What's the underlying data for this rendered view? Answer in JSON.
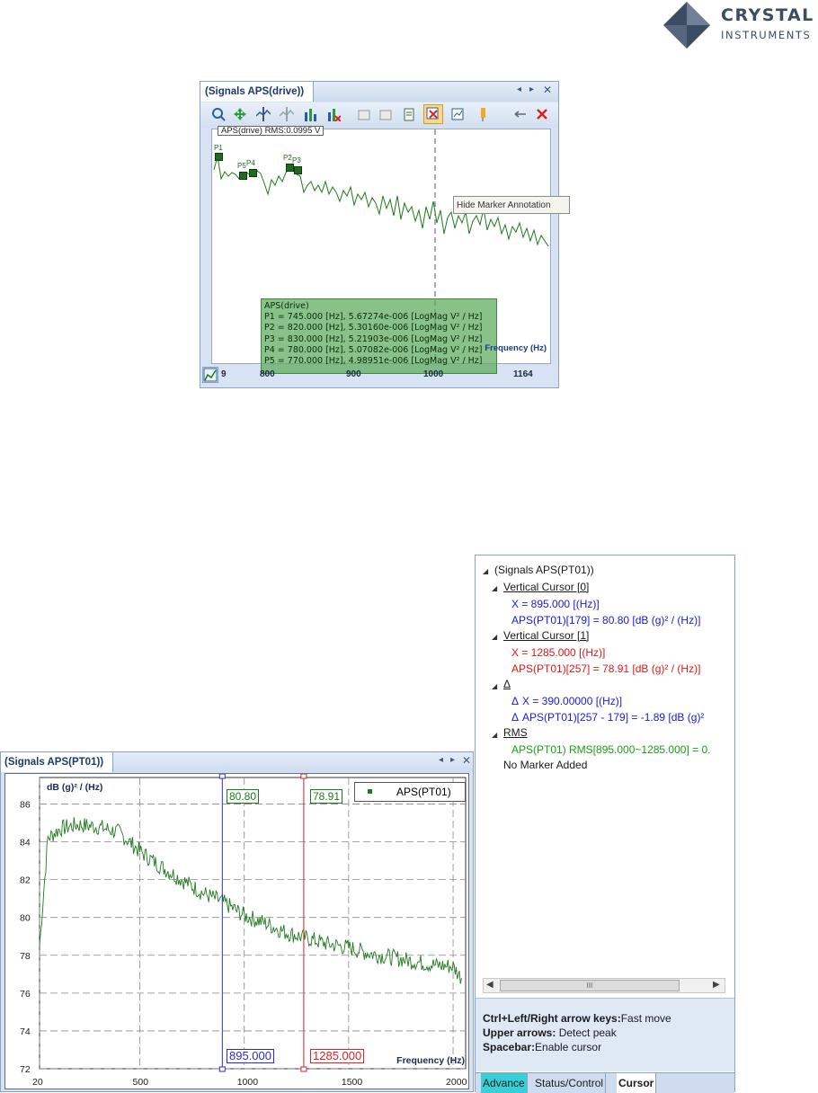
{
  "logo": {
    "line1": "CRYSTAL",
    "line2": "INSTRUMENTS"
  },
  "top_window": {
    "tab_title": "(Signals APS(drive))",
    "legend_title": "APS(drive) RMS:0.0995 V",
    "tooltip": "Hide Marker Annotation",
    "markers": [
      "P1",
      "P5",
      "P4",
      "P2",
      "P3"
    ],
    "annotation": {
      "title": "APS(drive)",
      "lines": [
        "P1 = 745.000 [Hz], 5.67274e-006 [LogMag V² / Hz]",
        "P2 = 820.000 [Hz], 5.30160e-006 [LogMag V² / Hz]",
        "P3 = 830.000 [Hz], 5.21903e-006 [LogMag V² / Hz]",
        "P4 = 780.000 [Hz], 5.07082e-006 [LogMag V² / Hz]",
        "P5 = 770.000 [Hz], 4.98951e-006 [LogMag V² / Hz]"
      ]
    },
    "xaxis_label": "Frequency (Hz)",
    "x_ticks": [
      "9",
      "800",
      "900",
      "1000",
      "1164"
    ]
  },
  "tree": {
    "root": "(Signals APS(PT01))",
    "cursor0": {
      "header": "Vertical Cursor [0]",
      "x": "X = 895.000 [(Hz)]",
      "y": "APS(PT01)[179] = 80.80 [dB (g)² / (Hz)]"
    },
    "cursor1": {
      "header": "Vertical Cursor [1]",
      "x": "X = 1285.000 [(Hz)]",
      "y": "APS(PT01)[257] = 78.91 [dB (g)² / (Hz)]"
    },
    "delta": {
      "header": "Δ",
      "dx": "X = 390.00000 [(Hz)]",
      "dy": "APS(PT01)[257 - 179] = -1.89 [dB (g)²"
    },
    "rms": {
      "header": "RMS",
      "value": "APS(PT01) RMS[895.000~1285.000] = 0."
    },
    "no_marker": "No Marker Added",
    "scroll_thumb": "III",
    "hints": [
      {
        "key": "Ctrl+Left/Right arrow keys:",
        "desc": "Fast move"
      },
      {
        "key": "Upper arrows:",
        "desc": " Detect peak"
      },
      {
        "key": "Spacebar:",
        "desc": "Enable cursor"
      }
    ],
    "bottom_tabs": [
      "Advance",
      "Status/Control",
      "Cursor"
    ]
  },
  "bottom_window": {
    "tab_title": "(Signals APS(PT01))",
    "ylabel": "dB (g)² / (Hz)",
    "legend": "APS(PT01)",
    "cursor_left": {
      "x": "895.000",
      "y": "80.80"
    },
    "cursor_right": {
      "x": "1285.000",
      "y": "78.91"
    },
    "xaxis_label": "Frequency (Hz)"
  },
  "chart_data": {
    "type": "line",
    "series": [
      {
        "name": "APS(PT01)",
        "color": "#1f7a1f"
      }
    ],
    "x": [
      20,
      60,
      120,
      200,
      300,
      400,
      500,
      600,
      700,
      800,
      900,
      1000,
      1100,
      1200,
      1300,
      1400,
      1500,
      1600,
      1700,
      1800,
      1900,
      2000,
      2040
    ],
    "y": [
      78.5,
      84.2,
      84.7,
      84.9,
      84.8,
      84.5,
      83.5,
      82.7,
      82.0,
      81.3,
      80.8,
      80.1,
      79.7,
      79.2,
      78.9,
      78.6,
      78.4,
      78.1,
      77.9,
      77.7,
      77.5,
      77.4,
      76.8
    ],
    "y_ticks": [
      72,
      74,
      76,
      78,
      80,
      82,
      84,
      86
    ],
    "x_ticks": [
      20,
      500,
      1000,
      1500,
      2000
    ],
    "xlim": [
      20,
      2060
    ],
    "ylim": [
      72,
      87.4
    ],
    "grid": true,
    "legend_position": "top-right",
    "cursors": [
      {
        "x": 895,
        "y": 80.8,
        "color": "#2b2bcc"
      },
      {
        "x": 1285,
        "y": 78.91,
        "color": "#d22"
      }
    ]
  }
}
